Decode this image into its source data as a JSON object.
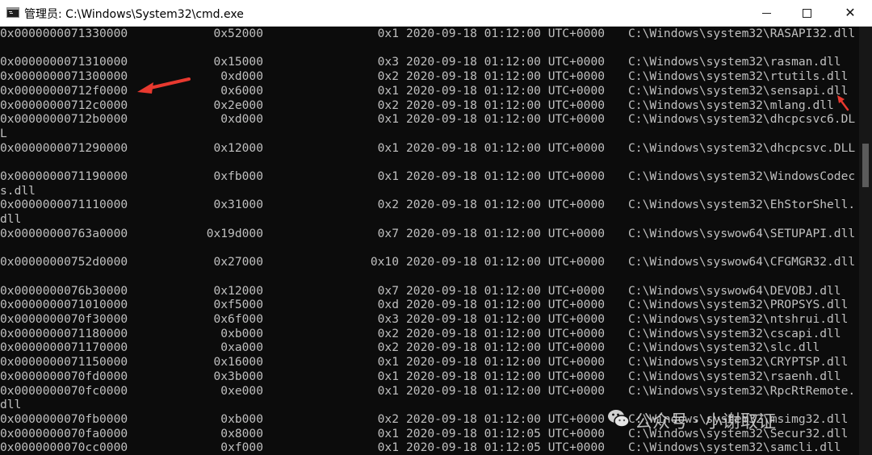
{
  "window": {
    "title": "管理员: C:\\Windows\\System32\\cmd.exe",
    "icon": "cmd-icon",
    "controls": [
      "minimize-icon",
      "maximize-icon",
      "close-icon"
    ],
    "close_glyph": "✕"
  },
  "rows": [
    {
      "base": "0x0000000071330000",
      "size": "0x52000",
      "flag": "0x1",
      "date": "2020-09-18 01:12:00 UTC+0000",
      "path": "C:\\Windows\\system32\\RASAPI32.dll",
      "overflow": ""
    },
    {
      "base": "0x0000000071310000",
      "size": "0x15000",
      "flag": "0x3",
      "date": "2020-09-18 01:12:00 UTC+0000",
      "path": "C:\\Windows\\system32\\rasman.dll",
      "overflow": ""
    },
    {
      "base": "0x0000000071300000",
      "size": "0xd000",
      "flag": "0x2",
      "date": "2020-09-18 01:12:00 UTC+0000",
      "path": "C:\\Windows\\system32\\rtutils.dll",
      "overflow": ""
    },
    {
      "base": "0x00000000712f0000",
      "size": "0x6000",
      "flag": "0x1",
      "date": "2020-09-18 01:12:00 UTC+0000",
      "path": "C:\\Windows\\system32\\sensapi.dll",
      "overflow": ""
    },
    {
      "base": "0x00000000712c0000",
      "size": "0x2e000",
      "flag": "0x2",
      "date": "2020-09-18 01:12:00 UTC+0000",
      "path": "C:\\Windows\\system32\\mlang.dll",
      "overflow": ""
    },
    {
      "base": "0x00000000712b0000",
      "size": "0xd000",
      "flag": "0x1",
      "date": "2020-09-18 01:12:00 UTC+0000",
      "path": "C:\\Windows\\system32\\dhcpcsvc6.DL",
      "overflow": "L"
    },
    {
      "base": "0x0000000071290000",
      "size": "0x12000",
      "flag": "0x1",
      "date": "2020-09-18 01:12:00 UTC+0000",
      "path": "C:\\Windows\\system32\\dhcpcsvc.DLL",
      "overflow": ""
    },
    {
      "base": "0x0000000071190000",
      "size": "0xfb000",
      "flag": "0x1",
      "date": "2020-09-18 01:12:00 UTC+0000",
      "path": "C:\\Windows\\system32\\WindowsCodec",
      "overflow": "s.dll"
    },
    {
      "base": "0x0000000071110000",
      "size": "0x31000",
      "flag": "0x2",
      "date": "2020-09-18 01:12:00 UTC+0000",
      "path": "C:\\Windows\\system32\\EhStorShell.",
      "overflow": "dll"
    },
    {
      "base": "0x00000000763a0000",
      "size": "0x19d000",
      "flag": "0x7",
      "date": "2020-09-18 01:12:00 UTC+0000",
      "path": "C:\\Windows\\syswow64\\SETUPAPI.dll",
      "overflow": ""
    },
    {
      "base": "0x00000000752d0000",
      "size": "0x27000",
      "flag": "0x10",
      "date": "2020-09-18 01:12:00 UTC+0000",
      "path": "C:\\Windows\\syswow64\\CFGMGR32.dll",
      "overflow": ""
    },
    {
      "base": "0x0000000076b30000",
      "size": "0x12000",
      "flag": "0x7",
      "date": "2020-09-18 01:12:00 UTC+0000",
      "path": "C:\\Windows\\syswow64\\DEVOBJ.dll",
      "overflow": ""
    },
    {
      "base": "0x0000000071010000",
      "size": "0xf5000",
      "flag": "0xd",
      "date": "2020-09-18 01:12:00 UTC+0000",
      "path": "C:\\Windows\\system32\\PROPSYS.dll",
      "overflow": ""
    },
    {
      "base": "0x0000000070f30000",
      "size": "0x6f000",
      "flag": "0x3",
      "date": "2020-09-18 01:12:00 UTC+0000",
      "path": "C:\\Windows\\system32\\ntshrui.dll",
      "overflow": ""
    },
    {
      "base": "0x0000000071180000",
      "size": "0xb000",
      "flag": "0x2",
      "date": "2020-09-18 01:12:00 UTC+0000",
      "path": "C:\\Windows\\system32\\cscapi.dll",
      "overflow": ""
    },
    {
      "base": "0x0000000071170000",
      "size": "0xa000",
      "flag": "0x2",
      "date": "2020-09-18 01:12:00 UTC+0000",
      "path": "C:\\Windows\\system32\\slc.dll",
      "overflow": ""
    },
    {
      "base": "0x0000000071150000",
      "size": "0x16000",
      "flag": "0x1",
      "date": "2020-09-18 01:12:00 UTC+0000",
      "path": "C:\\Windows\\system32\\CRYPTSP.dll",
      "overflow": ""
    },
    {
      "base": "0x0000000070fd0000",
      "size": "0x3b000",
      "flag": "0x1",
      "date": "2020-09-18 01:12:00 UTC+0000",
      "path": "C:\\Windows\\system32\\rsaenh.dll",
      "overflow": ""
    },
    {
      "base": "0x0000000070fc0000",
      "size": "0xe000",
      "flag": "0x1",
      "date": "2020-09-18 01:12:00 UTC+0000",
      "path": "C:\\Windows\\system32\\RpcRtRemote.",
      "overflow": "dll"
    },
    {
      "base": "0x0000000070fb0000",
      "size": "0xb000",
      "flag": "0x2",
      "date": "2020-09-18 01:12:00 UTC+0000",
      "path": "C:\\Windows\\system32\\msimg32.dll",
      "overflow": ""
    },
    {
      "base": "0x0000000070fa0000",
      "size": "0x8000",
      "flag": "0x1",
      "date": "2020-09-18 01:12:05 UTC+0000",
      "path": "C:\\Windows\\system32\\Secur32.dll",
      "overflow": ""
    },
    {
      "base": "0x0000000070cc0000",
      "size": "0xf000",
      "flag": "0x1",
      "date": "2020-09-18 01:12:05 UTC+0000",
      "path": "C:\\Windows\\system32\\samcli.dll",
      "overflow": ""
    }
  ],
  "annotations": {
    "color": "#e8392f",
    "icons": [
      "red-arrow-icon",
      "red-arrow-icon"
    ]
  },
  "watermark": {
    "text": "公众号 · 小谢取证",
    "icon": "wechat-icon"
  },
  "colors": {
    "console_bg": "#0c0c0c",
    "console_text": "#c0c0c0",
    "titlebar_bg": "#ffffff"
  }
}
